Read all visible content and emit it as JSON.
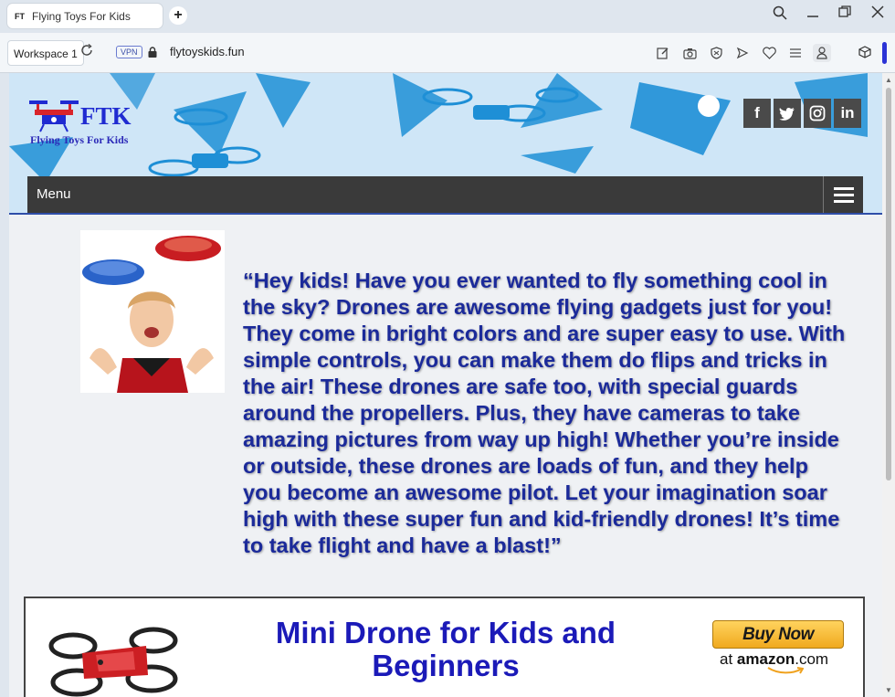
{
  "browser": {
    "tab_favicon": "FT",
    "tab_title": "Flying Toys For Kids",
    "new_tab": "+",
    "workspace": "Workspace 1",
    "vpn": "VPN",
    "url": "flytoyskids.fun",
    "accent_color": "#2b33d6"
  },
  "header": {
    "logo_text": "FTK",
    "logo_subtitle": "Flying Toys For Kids",
    "social": [
      "f",
      "t",
      "i",
      "in"
    ],
    "menu_label": "Menu"
  },
  "main": {
    "intro_paragraph": "“Hey kids! Have you ever wanted to fly something cool in the sky? Drones are awesome flying gadgets just for you! They come in bright colors and are super easy to use. With simple controls, you can make them do flips and tricks in the air! These drones are safe too, with special guards around the propellers. Plus, they have cameras to take amazing pictures from way up high! Whether you’re inside or outside, these drones are loads of fun, and they help you become an awesome pilot. Let your imagination soar high with these super fun and kid-friendly drones! It’s time to take flight and have a blast!”"
  },
  "product": {
    "title": "Mini Drone for Kids and Beginners",
    "buy_label": "Buy Now",
    "at_label": "at",
    "store_label": "amazon",
    "store_suffix": ".com"
  }
}
